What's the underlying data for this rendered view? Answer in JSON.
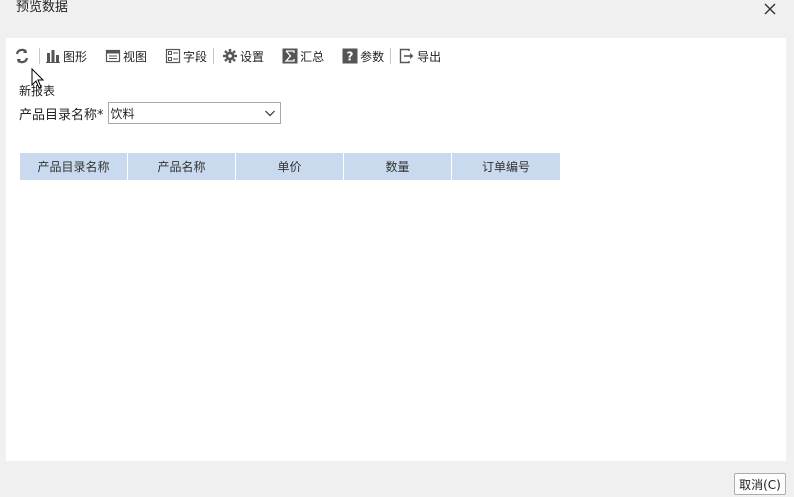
{
  "window": {
    "title": "预览数据",
    "close_icon": "close-icon"
  },
  "toolbar": {
    "refresh_icon": "refresh-icon",
    "items": [
      {
        "label": "图形",
        "icon": "bar-chart-icon"
      },
      {
        "label": "视图",
        "icon": "view-icon"
      },
      {
        "label": "字段",
        "icon": "field-icon"
      },
      {
        "label": "设置",
        "icon": "gear-icon"
      },
      {
        "label": "汇总",
        "icon": "sigma-icon"
      },
      {
        "label": "参数",
        "icon": "question-icon"
      },
      {
        "label": "导出",
        "icon": "export-icon"
      }
    ]
  },
  "report": {
    "title": "新报表",
    "parameter": {
      "label": "产品目录名称*",
      "value": "饮料"
    },
    "columns": [
      "产品目录名称",
      "产品名称",
      "单价",
      "数量",
      "订单编号"
    ]
  },
  "footer": {
    "cancel_label": "取消(C)"
  },
  "colors": {
    "header_bg": "#c9daef",
    "panel_bg": "#ffffff",
    "window_bg": "#f0f0f0"
  }
}
